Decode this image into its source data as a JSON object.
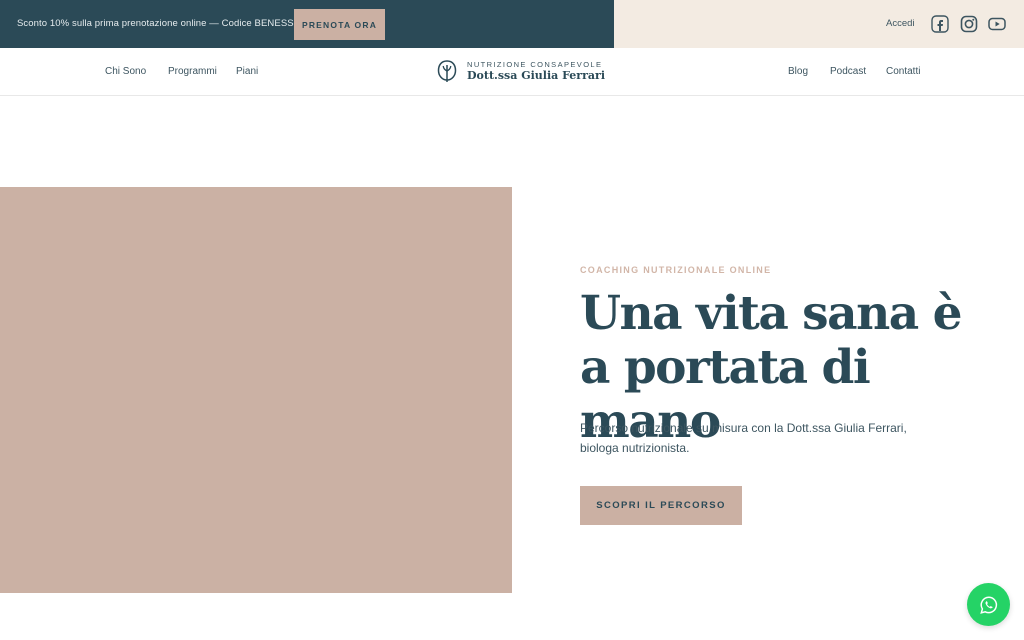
{
  "topbar": {
    "promo_text": "Sconto 10% sulla prima prenotazione online — Codice BENESSERE",
    "promo_button": "PRENOTA ORA",
    "login": "Accedi",
    "socials": [
      "facebook-icon",
      "instagram-icon",
      "youtube-icon"
    ]
  },
  "nav": {
    "left": [
      "Chi Sono",
      "Programmi",
      "Piani"
    ],
    "right": [
      "Blog",
      "Podcast",
      "Contatti"
    ],
    "logo_small": "NUTRIZIONE CONSAPEVOLE",
    "logo_name": "Dott.ssa Giulia Ferrari"
  },
  "hero": {
    "eyebrow": "COACHING NUTRIZIONALE ONLINE",
    "headline": "Una vita sana è a portata di mano",
    "subtext": "Percorso nutrizionale su misura con la Dott.ssa Giulia Ferrari, biologa nutrizionista.",
    "cta": "SCOPRI IL PERCORSO",
    "image_color": "#cbb1a4"
  },
  "colors": {
    "primary": "#2b4a57",
    "accent": "#cbb0a3",
    "cream": "#f3ebe2",
    "whatsapp": "#25d366"
  }
}
